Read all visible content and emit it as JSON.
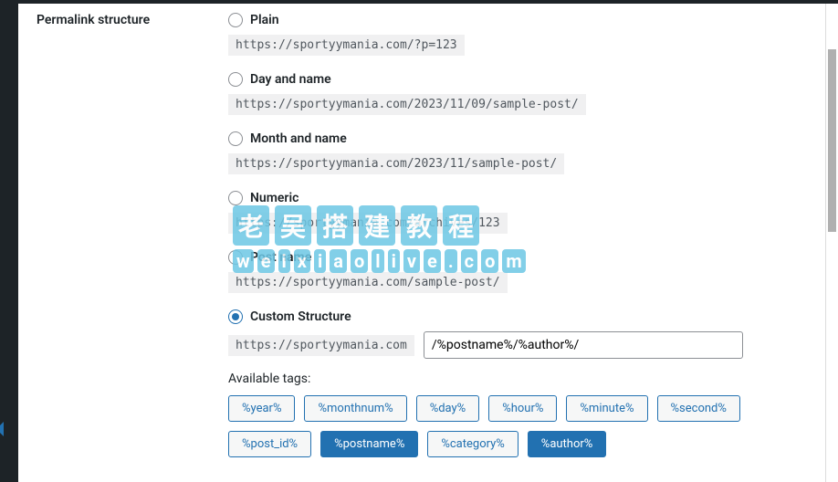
{
  "section_label": "Permalink structure",
  "options": {
    "plain": {
      "label": "Plain",
      "url": "https://sportyymania.com/?p=123"
    },
    "day_name": {
      "label": "Day and name",
      "url": "https://sportyymania.com/2023/11/09/sample-post/"
    },
    "month_name": {
      "label": "Month and name",
      "url": "https://sportyymania.com/2023/11/sample-post/"
    },
    "numeric": {
      "label": "Numeric",
      "url": "https://sportyymania.com/archives/123"
    },
    "post_name": {
      "label": "Post name",
      "url": "https://sportyymania.com/sample-post/"
    },
    "custom": {
      "label": "Custom Structure",
      "base_url": "https://sportyymania.com",
      "value": "/%postname%/%author%/"
    }
  },
  "available_tags_label": "Available tags:",
  "tags_row1": [
    "%year%",
    "%monthnum%",
    "%day%",
    "%hour%",
    "%minute%",
    "%second%"
  ],
  "tags_row2": [
    "%post_id%",
    "%postname%",
    "%category%",
    "%author%"
  ],
  "active_tags": [
    "%postname%",
    "%author%"
  ],
  "watermark": {
    "line1": "老吴搭建教程",
    "line2": "weixiaolive.com"
  }
}
